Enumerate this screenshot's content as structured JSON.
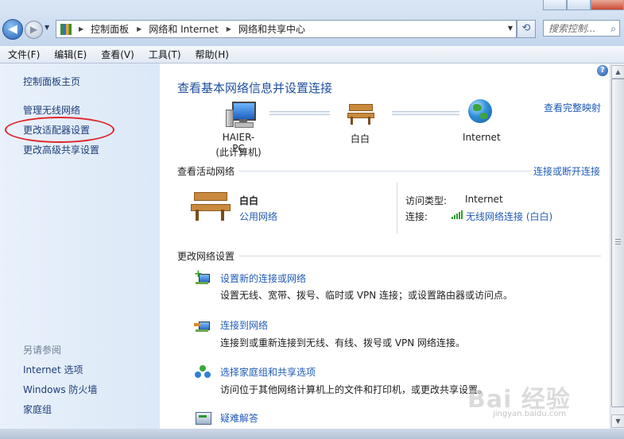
{
  "address": {
    "crumbs": [
      "控制面板",
      "网络和 Internet",
      "网络和共享中心"
    ],
    "search_placeholder": "搜索控制..."
  },
  "menu": [
    "文件(F)",
    "编辑(E)",
    "查看(V)",
    "工具(T)",
    "帮助(H)"
  ],
  "left_nav": {
    "home": "控制面板主页",
    "links": [
      "管理无线网络",
      "更改适配器设置",
      "更改高级共享设置"
    ],
    "see_also_title": "另请参阅",
    "see_also": [
      "Internet 选项",
      "Windows 防火墙",
      "家庭组"
    ]
  },
  "main": {
    "title": "查看基本网络信息并设置连接",
    "full_map_link": "查看完整映射",
    "map": {
      "computer_name": "HAIER-PC",
      "computer_sub": "(此计算机)",
      "network_name": "白白",
      "internet": "Internet"
    },
    "active_section_title": "查看活动网络",
    "connect_disconnect_link": "连接或断开连接",
    "active_network": {
      "name": "白白",
      "type_link": "公用网络",
      "access_type_label": "访问类型:",
      "access_type_value": "Internet",
      "connection_label": "连接:",
      "connection_value": "无线网络连接 (白白)"
    },
    "change_section_title": "更改网络设置",
    "tasks": [
      {
        "title": "设置新的连接或网络",
        "desc": "设置无线、宽带、拨号、临时或 VPN 连接；或设置路由器或访问点。"
      },
      {
        "title": "连接到网络",
        "desc": "连接到或重新连接到无线、有线、拨号或 VPN 网络连接。"
      },
      {
        "title": "选择家庭组和共享选项",
        "desc": "访问位于其他网络计算机上的文件和打印机，或更改共享设置。"
      },
      {
        "title": "疑难解答",
        "desc": ""
      }
    ]
  },
  "help_glyph": "?",
  "watermark": {
    "main": "Bai 经验",
    "sub": "jingyan.baidu.com"
  },
  "colors": {
    "link": "#1f5bb5",
    "nav_link": "#1f3d7a",
    "highlight_ring": "#e0242b",
    "title": "#1e4f9c"
  }
}
